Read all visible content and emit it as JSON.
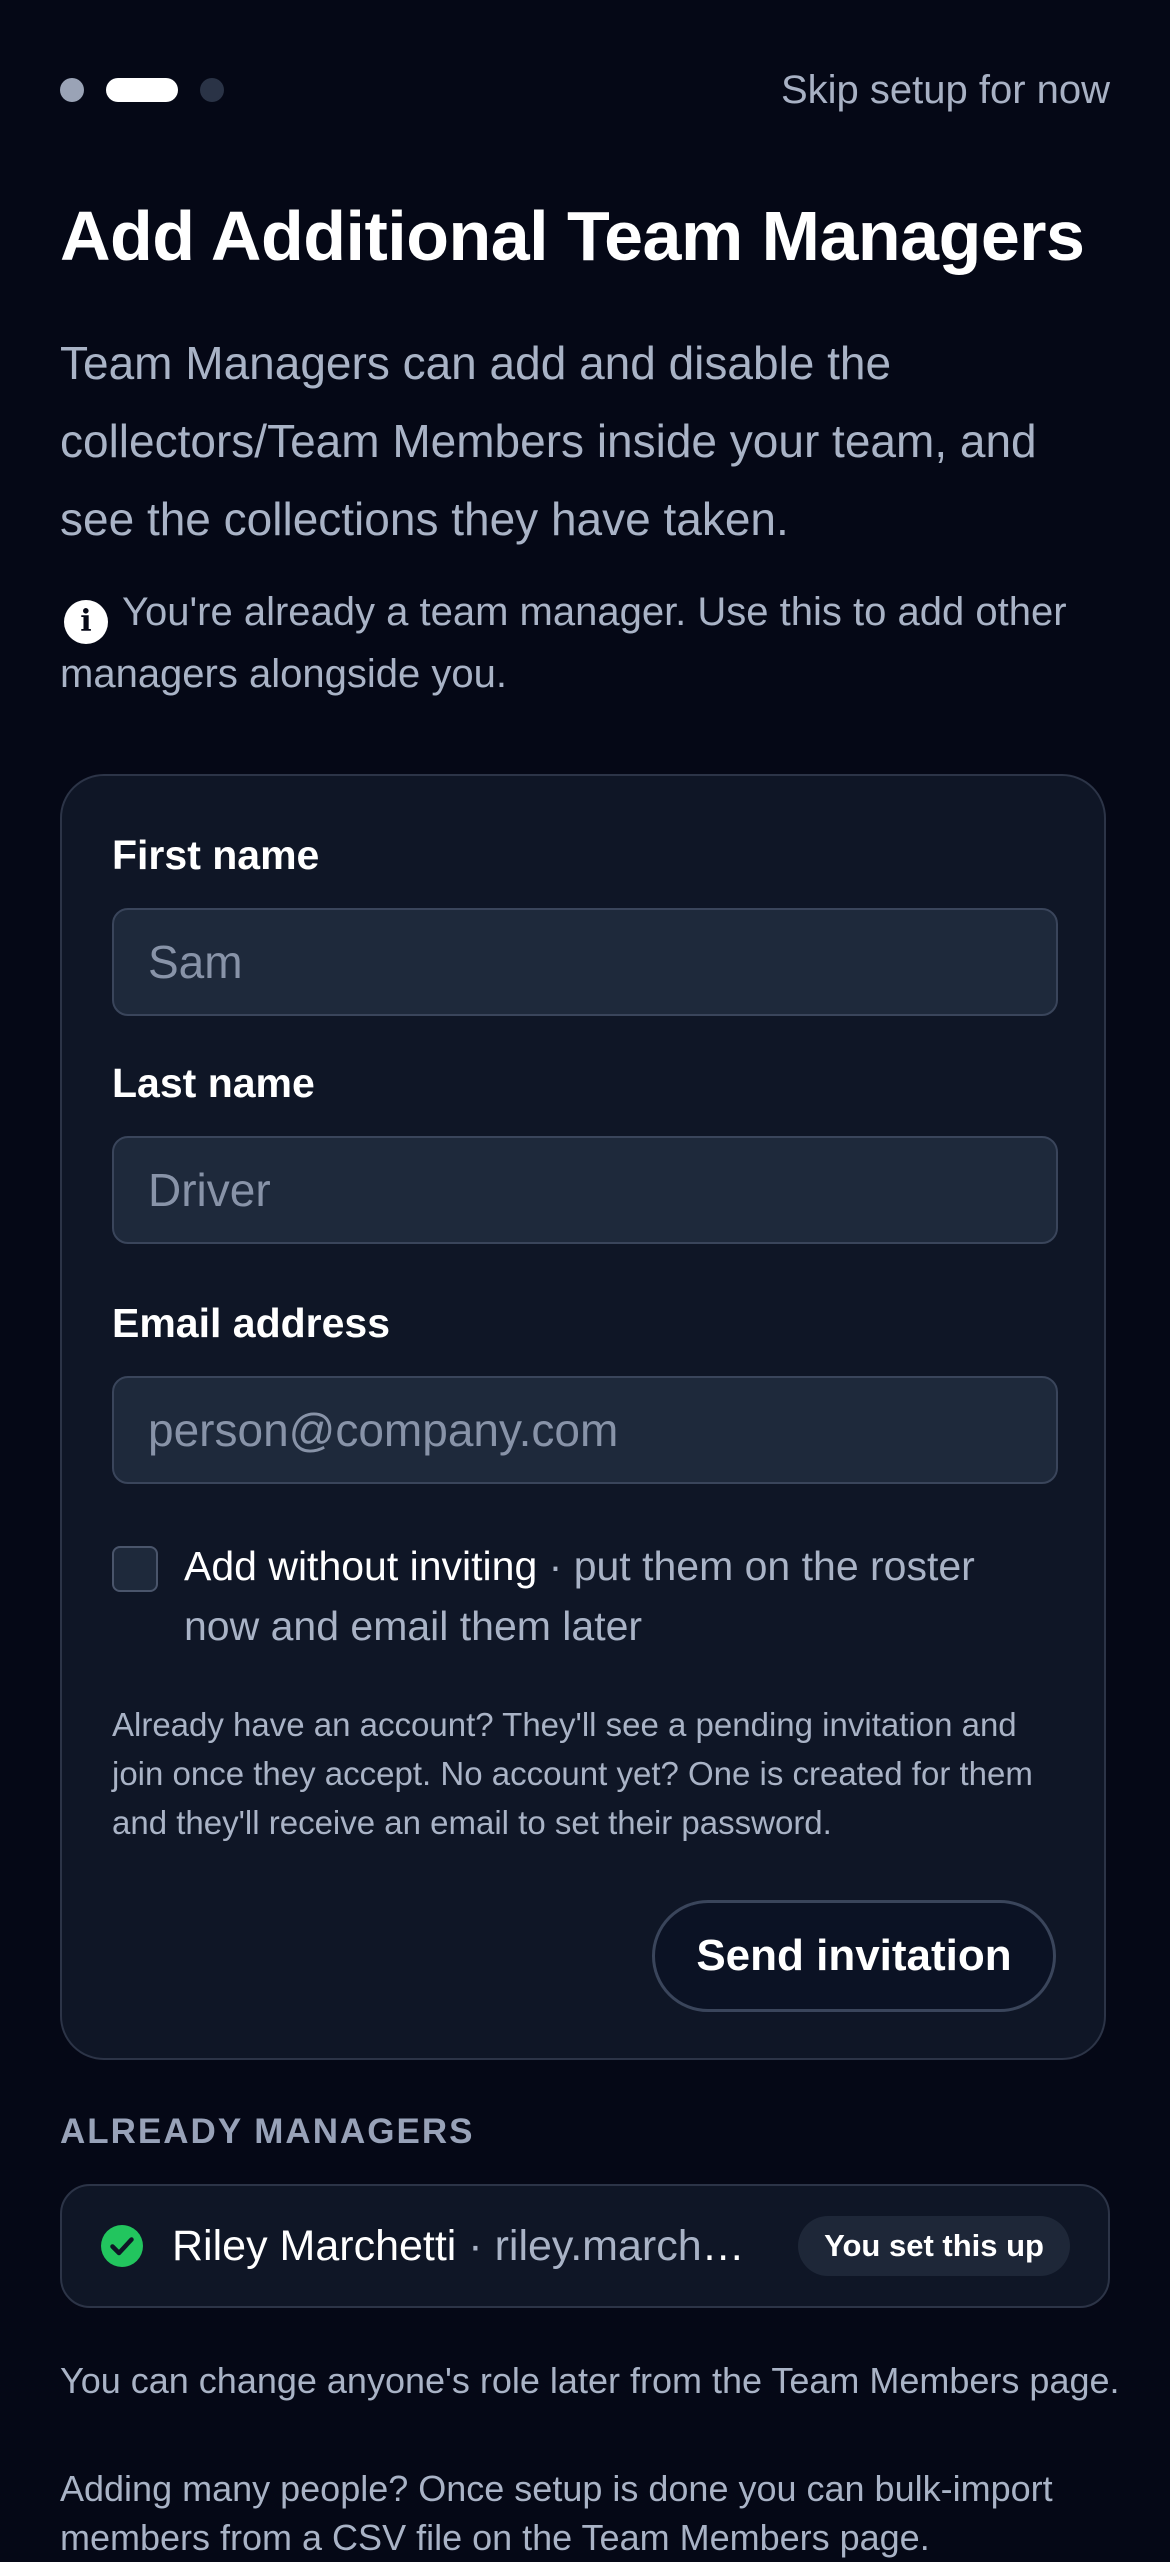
{
  "header": {
    "steps": [
      "done",
      "active",
      "upcoming"
    ],
    "skip_label": "Skip setup for now"
  },
  "title": "Add Additional Team Managers",
  "intro": "Team Managers can add and disable the collectors/Team Members inside your team, and see the collections they have taken.",
  "note": {
    "icon": "info-icon",
    "text": "You're already a team manager. Use this to add other managers alongside you."
  },
  "form": {
    "first_name": {
      "label": "First name",
      "placeholder": "Sam",
      "value": ""
    },
    "last_name": {
      "label": "Last name",
      "placeholder": "Driver",
      "value": ""
    },
    "email": {
      "label": "Email address",
      "placeholder": "person@company.com",
      "value": ""
    },
    "add_without_inviting": {
      "checked": false,
      "label": "Add without inviting",
      "separator": " · ",
      "description": "put them on the roster now and email them later"
    },
    "helper": "Already have an account? They'll see a pending invitation and join once they accept. No account yet? One is created for them and they'll receive an email to set their password.",
    "submit_label": "Send invitation"
  },
  "managers": {
    "heading": "ALREADY MANAGERS",
    "items": [
      {
        "name": "Riley Marchetti",
        "separator": " · ",
        "email": "riley.marche...",
        "badge": "You set this up",
        "status_icon": "check-circle-icon"
      }
    ]
  },
  "footer": {
    "role_note": "You can change anyone's role later from the Team Members page.",
    "bulk_note": "Adding many people? Once setup is done you can bulk-import members from a CSV file on the Team Members page."
  },
  "colors": {
    "background": "#050816",
    "card": "#0f1626",
    "input": "#1e293b",
    "success": "#22c55e",
    "muted_text": "#a9b3c6"
  }
}
